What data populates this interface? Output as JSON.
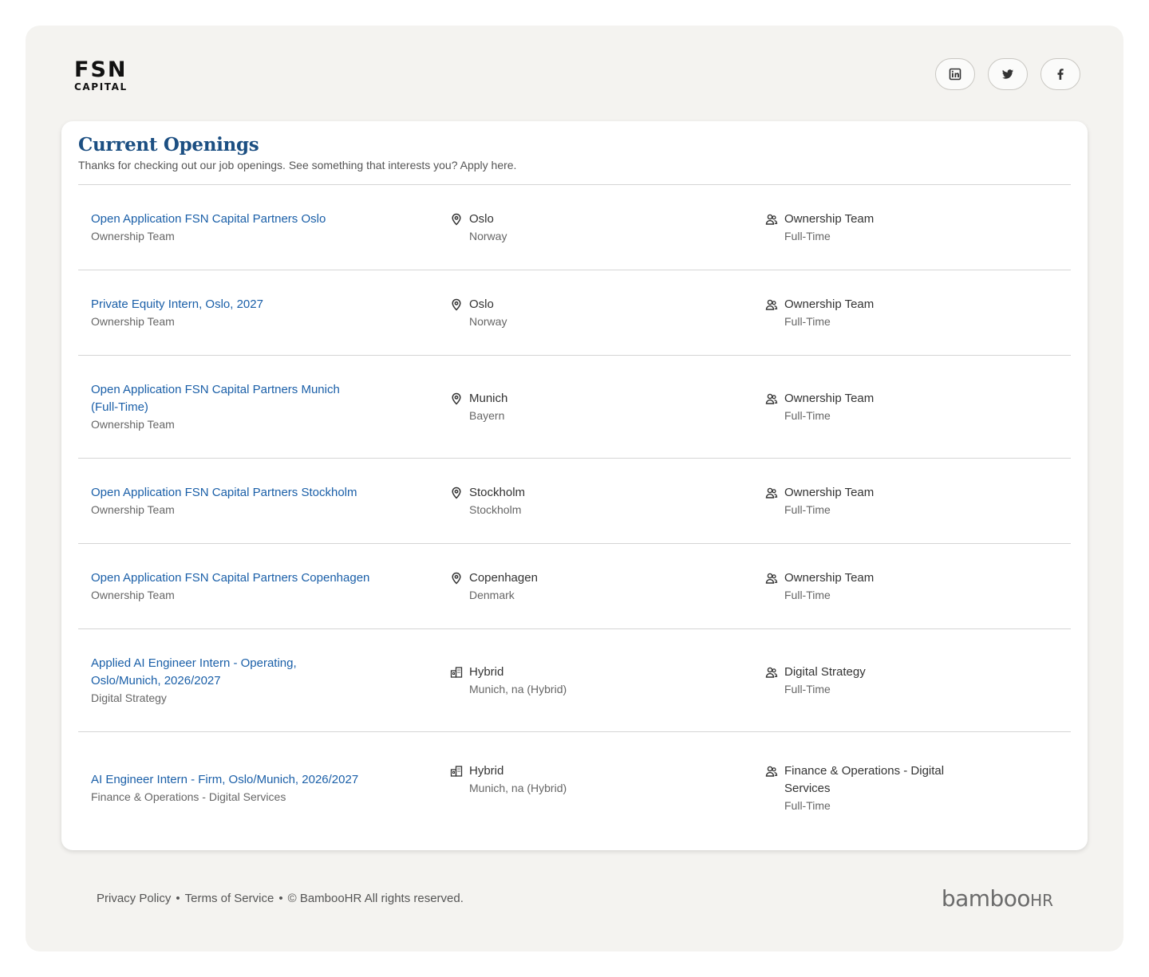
{
  "brand": {
    "logo_line1": "FSN",
    "logo_line2": "CAPITAL"
  },
  "socials": [
    {
      "icon": "linkedin-icon"
    },
    {
      "icon": "twitter-icon"
    },
    {
      "icon": "facebook-icon"
    }
  ],
  "openings": {
    "title": "Current Openings",
    "subtitle": "Thanks for checking out our job openings. See something that interests you? Apply here.",
    "jobs": [
      {
        "title": "Open Application FSN Capital Partners Oslo",
        "department": "Ownership Team",
        "location_type": "location-pin-icon",
        "location": "Oslo",
        "region": "Norway",
        "team": "Ownership Team",
        "employment": "Full-Time"
      },
      {
        "title": "Private Equity Intern, Oslo, 2027",
        "department": "Ownership Team",
        "location_type": "location-pin-icon",
        "location": "Oslo",
        "region": "Norway",
        "team": "Ownership Team",
        "employment": "Full-Time"
      },
      {
        "title": "Open Application FSN Capital Partners Munich (Full-Time)",
        "department": "Ownership Team",
        "location_type": "location-pin-icon",
        "location": "Munich",
        "region": "Bayern",
        "team": "Ownership Team",
        "employment": "Full-Time"
      },
      {
        "title": "Open Application FSN Capital Partners Stockholm",
        "department": "Ownership Team",
        "location_type": "location-pin-icon",
        "location": "Stockholm",
        "region": "Stockholm",
        "team": "Ownership Team",
        "employment": "Full-Time"
      },
      {
        "title": "Open Application FSN Capital Partners Copenhagen",
        "department": "Ownership Team",
        "location_type": "location-pin-icon",
        "location": "Copenhagen",
        "region": "Denmark",
        "team": "Ownership Team",
        "employment": "Full-Time"
      },
      {
        "title": "Applied AI Engineer Intern - Operating, Oslo/Munich, 2026/2027",
        "department": "Digital Strategy",
        "location_type": "hybrid-building-icon",
        "location": "Hybrid",
        "region": "Munich, na (Hybrid)",
        "team": "Digital Strategy",
        "employment": "Full-Time"
      },
      {
        "title": "AI Engineer Intern - Firm, Oslo/Munich, 2026/2027",
        "department": "Finance & Operations - Digital Services",
        "location_type": "hybrid-building-icon",
        "location": "Hybrid",
        "region": "Munich, na (Hybrid)",
        "team": "Finance & Operations - Digital Services",
        "employment": "Full-Time"
      }
    ]
  },
  "footer": {
    "privacy": "Privacy Policy",
    "terms": "Terms of Service",
    "copyright": "© BambooHR All rights reserved.",
    "brand_main": "bamboo",
    "brand_suffix": "HR"
  },
  "colors": {
    "accent": "#1c4f82",
    "link": "#1a5fa8",
    "frame_bg": "#f4f3f0"
  }
}
